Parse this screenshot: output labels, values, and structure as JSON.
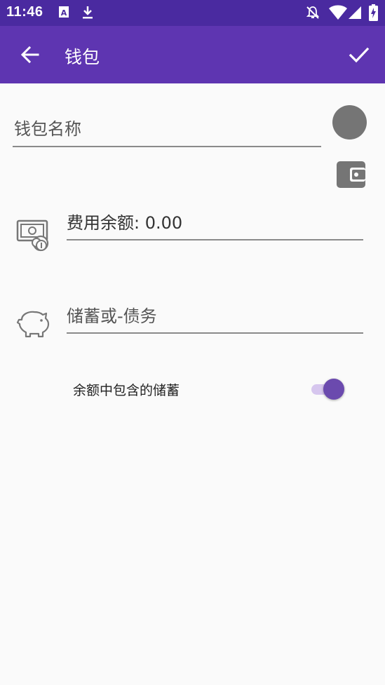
{
  "status_bar": {
    "time": "11:46",
    "icons": [
      "a-box-icon",
      "download-icon",
      "bell-off-icon",
      "wifi-icon",
      "signal-icon",
      "battery-charging-icon"
    ]
  },
  "app_bar": {
    "title": "钱包",
    "back_icon": "arrow-back-icon",
    "save_icon": "check-icon",
    "color": "#5e35b1"
  },
  "form": {
    "name_placeholder": "钱包名称",
    "name_value": "",
    "wallet_color": "#757575",
    "expense_label": "费用余额: 0.00",
    "savings_placeholder": "储蓄或-债务",
    "savings_value": ""
  },
  "toggle": {
    "label": "余额中包含的储蓄",
    "checked": true,
    "accent": "#6b4aae"
  }
}
